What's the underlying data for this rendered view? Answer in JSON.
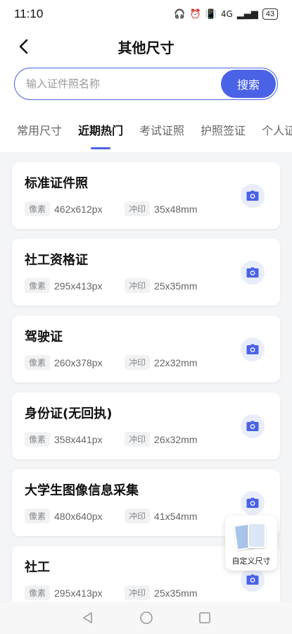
{
  "status": {
    "time": "11:10",
    "network": "4G",
    "battery": "43"
  },
  "header": {
    "title": "其他尺寸"
  },
  "search": {
    "placeholder": "输入证件照名称",
    "button_label": "搜索"
  },
  "tabs": [
    {
      "label": "常用尺寸",
      "active": false
    },
    {
      "label": "近期热门",
      "active": true
    },
    {
      "label": "考试证照",
      "active": false
    },
    {
      "label": "护照签证",
      "active": false
    },
    {
      "label": "个人证照",
      "active": false
    }
  ],
  "meta_labels": {
    "pixel": "像素",
    "print": "冲印"
  },
  "cards": [
    {
      "title": "标准证件照",
      "pixels": "462x612px",
      "print": "35x48mm"
    },
    {
      "title": "社工资格证",
      "pixels": "295x413px",
      "print": "25x35mm"
    },
    {
      "title": "驾驶证",
      "pixels": "260x378px",
      "print": "22x32mm"
    },
    {
      "title": "身份证(无回执)",
      "pixels": "358x441px",
      "print": "26x32mm"
    },
    {
      "title": "大学生图像信息采集",
      "pixels": "480x640px",
      "print": "41x54mm"
    },
    {
      "title": "社工",
      "pixels": "295x413px",
      "print": "25x35mm"
    }
  ],
  "float_button": {
    "label": "自定义尺寸"
  },
  "colors": {
    "accent": "#4a63e6",
    "background": "#f4f5f7"
  }
}
